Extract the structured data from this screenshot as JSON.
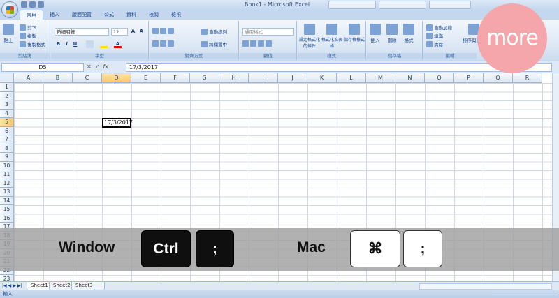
{
  "window": {
    "title": "Book1 - Microsoft Excel"
  },
  "ribbon": {
    "tabs": [
      "常用",
      "插入",
      "版面配置",
      "公式",
      "資料",
      "校閱",
      "檢視"
    ],
    "clipboard": {
      "paste": "貼上",
      "cut": "剪下",
      "copy": "複製",
      "format_painter": "複製格式",
      "label": "剪貼簿"
    },
    "font": {
      "name": "新細明體",
      "size": "12",
      "label": "字型"
    },
    "alignment": {
      "wrap": "自動換列",
      "merge": "跨欄置中",
      "label": "對齊方式"
    },
    "number": {
      "format": "通用格式",
      "label": "數值"
    },
    "styles": {
      "conditional": "設定格式化的條件",
      "as_table": "格式化為表格",
      "cell_styles": "儲存格樣式",
      "label": "樣式"
    },
    "cells": {
      "insert": "插入",
      "delete": "刪除",
      "format": "格式",
      "label": "儲存格"
    },
    "editing": {
      "autosum": "自動加總",
      "fill": "填滿",
      "clear": "清除",
      "sort": "排序與篩選",
      "label": "編輯"
    }
  },
  "formula_bar": {
    "name_box": "D5",
    "fx": "fx",
    "formula": "17/3/2017"
  },
  "grid": {
    "columns": [
      "A",
      "B",
      "C",
      "D",
      "E",
      "F",
      "G",
      "H",
      "I",
      "J",
      "K",
      "L",
      "M",
      "N",
      "O",
      "P",
      "Q",
      "R"
    ],
    "rows": [
      "1",
      "2",
      "3",
      "4",
      "5",
      "6",
      "7",
      "8",
      "9",
      "10",
      "11",
      "12",
      "13",
      "14",
      "15",
      "16",
      "17",
      "18",
      "19",
      "20",
      "21",
      "22",
      "23"
    ],
    "active_cell": "D5",
    "active_value": "17/3/2017"
  },
  "sheets": [
    "Sheet1",
    "Sheet2",
    "Sheet3"
  ],
  "status": {
    "mode": "輸入"
  },
  "shortcut": {
    "windows_label": "Window",
    "windows_keys": [
      "Ctrl",
      ";"
    ],
    "mac_label": "Mac",
    "mac_keys": [
      "⌘",
      ";"
    ]
  },
  "badge": {
    "text": "more",
    "color": "#f4a6ab"
  },
  "colors": {
    "ribbon": "#dae6f4",
    "selected_header": "#f9c96d",
    "overlay": "#a0a0a0"
  }
}
